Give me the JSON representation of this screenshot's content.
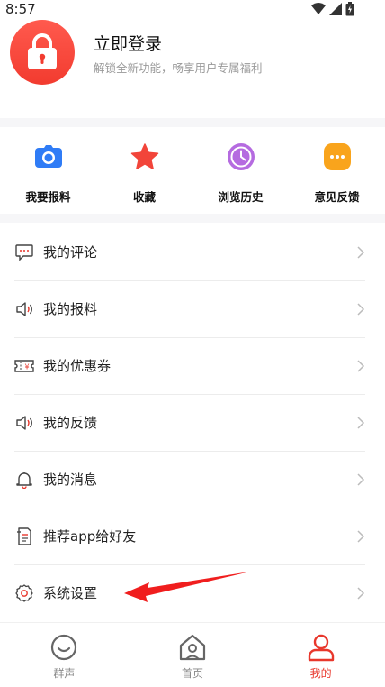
{
  "status_bar": {
    "time": "8:57"
  },
  "profile": {
    "title": "立即登录",
    "subtitle": "解锁全新功能，畅享用户专属福利"
  },
  "quick_actions": [
    {
      "label": "我要报料",
      "icon": "camera-icon",
      "color": "#2f7cf6"
    },
    {
      "label": "收藏",
      "icon": "star-icon",
      "color": "#f2453a"
    },
    {
      "label": "浏览历史",
      "icon": "clock-icon",
      "color": "#b56be0"
    },
    {
      "label": "意见反馈",
      "icon": "chat-bubble-icon",
      "color": "#f9a41c"
    }
  ],
  "menu": [
    {
      "label": "我的评论",
      "icon": "comment-icon"
    },
    {
      "label": "我的报料",
      "icon": "speaker-icon"
    },
    {
      "label": "我的优惠券",
      "icon": "coupon-icon"
    },
    {
      "label": "我的反馈",
      "icon": "speaker-icon"
    },
    {
      "label": "我的消息",
      "icon": "bell-icon"
    },
    {
      "label": "推荐app给好友",
      "icon": "share-doc-icon"
    },
    {
      "label": "系统设置",
      "icon": "gear-icon"
    }
  ],
  "bottom_nav": [
    {
      "label": "群声",
      "icon": "smile-face-icon",
      "active": false
    },
    {
      "label": "首页",
      "icon": "home-icon",
      "active": false
    },
    {
      "label": "我的",
      "icon": "user-icon",
      "active": true
    }
  ],
  "colors": {
    "accent": "#e8372c",
    "annotation_arrow": "#f01e1e"
  }
}
